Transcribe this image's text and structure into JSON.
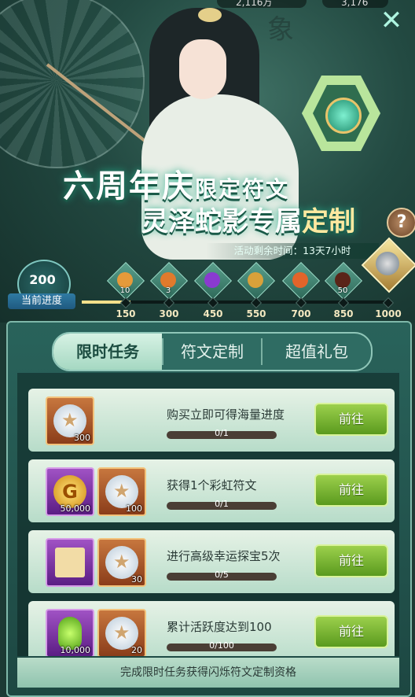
{
  "header": {
    "currency_left": "2,116万",
    "currency_right": "3,176",
    "lore_char": "象",
    "title_line1_main": "六周年庆",
    "title_line1_sub": "限定符文",
    "title_line2_main": "灵泽蛇影专属",
    "title_line2_accent": "定制",
    "countdown": "活动剩余时间：13天7小时",
    "help": "?",
    "close": "✕"
  },
  "progress": {
    "current": "200",
    "current_label": "当前进度",
    "fill_fraction": 0.16,
    "ticks": [
      "150",
      "300",
      "450",
      "550",
      "700",
      "850",
      "1000"
    ],
    "rewards": [
      {
        "count": "10",
        "color": "#e59a3a"
      },
      {
        "count": "3",
        "color": "#e07a2c"
      },
      {
        "count": "",
        "color": "#8a3ad0"
      },
      {
        "count": "",
        "color": "#d9a13a"
      },
      {
        "count": "",
        "color": "#e2642a"
      },
      {
        "count": "50",
        "color": "#5a2418"
      }
    ]
  },
  "tabs": [
    {
      "label": "限时任务",
      "active": true
    },
    {
      "label": "符文定制",
      "active": false
    },
    {
      "label": "超值礼包",
      "active": false
    }
  ],
  "tasks": [
    {
      "desc": "购买立即可得海量进度",
      "progress": "0/1",
      "button": "前往",
      "items": [
        {
          "type": "gem",
          "frame": "orange",
          "qty": "300"
        }
      ]
    },
    {
      "desc": "获得1个彩虹符文",
      "progress": "0/1",
      "button": "前往",
      "items": [
        {
          "type": "coin",
          "frame": "purple",
          "qty": "50,000"
        },
        {
          "type": "gem",
          "frame": "orange",
          "qty": "100"
        }
      ]
    },
    {
      "desc": "进行高级幸运探宝5次",
      "progress": "0/5",
      "button": "前往",
      "items": [
        {
          "type": "scroll",
          "frame": "purple",
          "qty": ""
        },
        {
          "type": "gem",
          "frame": "orange",
          "qty": "30"
        }
      ]
    },
    {
      "desc": "累计活跃度达到100",
      "progress": "0/100",
      "button": "前往",
      "items": [
        {
          "type": "potion",
          "frame": "purple",
          "qty": "10,000"
        },
        {
          "type": "gem",
          "frame": "orange",
          "qty": "20"
        }
      ]
    }
  ],
  "footer": "完成限时任务获得闪烁符文定制资格"
}
